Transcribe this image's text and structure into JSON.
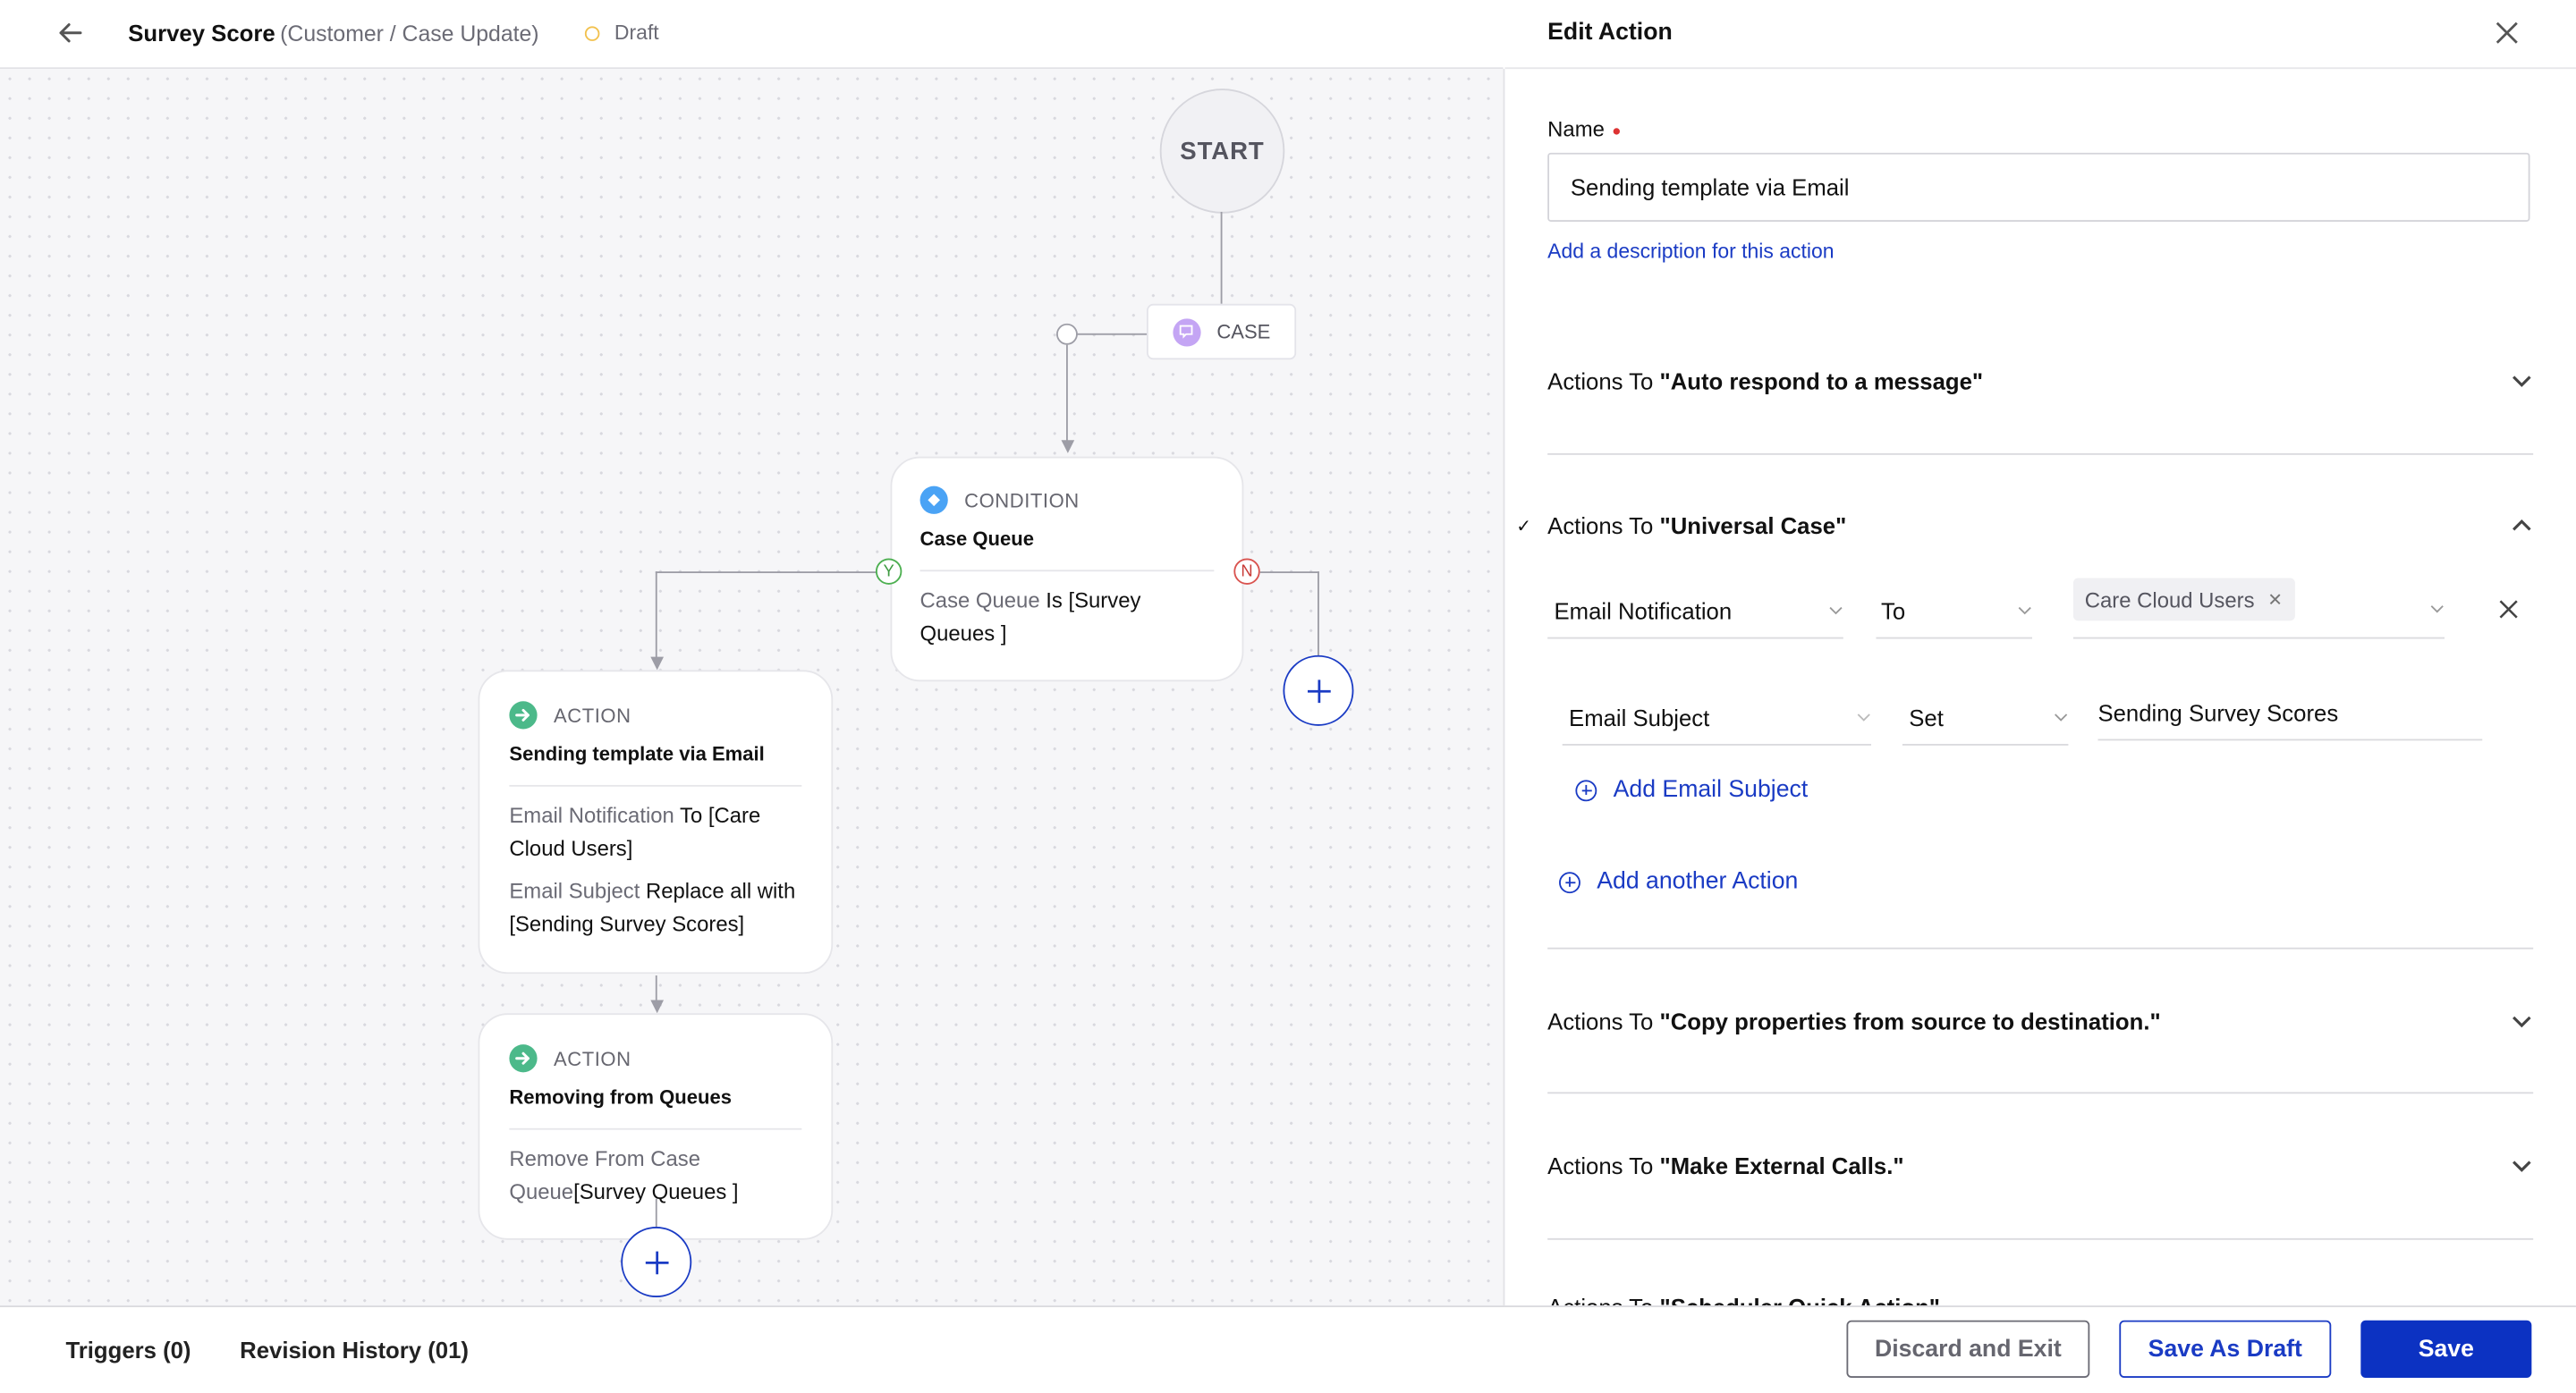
{
  "header": {
    "title": "Survey Score",
    "subtitle": "(Customer / Case Update)",
    "status": "Draft",
    "status_color": "#f2c14e"
  },
  "canvas": {
    "start_label": "START",
    "case_label": "CASE",
    "condition": {
      "type_label": "CONDITION",
      "title": "Case Queue",
      "field": "Case Queue",
      "rest": " Is [Survey Queues ]",
      "yes_label": "Y",
      "no_label": "N"
    },
    "action1": {
      "type_label": "ACTION",
      "title": "Sending template via Email",
      "line1_field": "Email Notification",
      "line1_rest": " To [Care Cloud Users]",
      "line2_field": "Email Subject",
      "line2_rest": " Replace all with [Sending Survey Scores]"
    },
    "action2": {
      "type_label": "ACTION",
      "title": "Removing from Queues",
      "line1_field": "Remove From Case Queue",
      "line1_rest": "[Survey Queues ]"
    }
  },
  "panel": {
    "title": "Edit Action",
    "name_label": "Name",
    "name_value": "Sending template via Email",
    "add_description": "Add a description for this action",
    "sections": [
      {
        "prefix": "Actions To ",
        "name": "\"Auto respond to a message\"",
        "expanded": false
      },
      {
        "prefix": "Actions To ",
        "name": "\"Universal Case\"",
        "expanded": true,
        "checked": true
      },
      {
        "prefix": "Actions To ",
        "name": "\"Copy properties from source to destination.\"",
        "expanded": false
      },
      {
        "prefix": "Actions To ",
        "name": "\"Make External Calls.\"",
        "expanded": false
      },
      {
        "prefix": "Actions To ",
        "name": "\"Scheduler Quick Action\"",
        "expanded": false
      }
    ],
    "universal_case": {
      "row1": {
        "field": "Email Notification",
        "operator": "To",
        "value_chip": "Care Cloud Users"
      },
      "row2": {
        "field": "Email Subject",
        "operator": "Set",
        "value": "Sending Survey Scores"
      },
      "add_email_subject": "Add Email Subject",
      "add_another_action": "Add another Action"
    }
  },
  "footer": {
    "triggers": "Triggers (0)",
    "revision_history": "Revision History (01)",
    "discard": "Discard and Exit",
    "save_draft": "Save As Draft",
    "save": "Save"
  }
}
